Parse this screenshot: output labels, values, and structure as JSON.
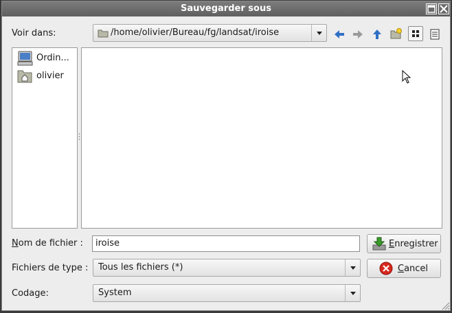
{
  "window": {
    "title": "Sauvegarder sous"
  },
  "location": {
    "label": "Voir dans:",
    "path": "/home/olivier/Bureau/fg/landsat/iroise"
  },
  "toolbar": {
    "icons": [
      "back-arrow-icon",
      "forward-arrow-icon",
      "up-arrow-icon",
      "new-folder-icon",
      "icon-view-icon",
      "list-view-icon"
    ]
  },
  "places": [
    {
      "label": "Ordin...",
      "icon": "computer-icon"
    },
    {
      "label": "olivier",
      "icon": "home-folder-icon"
    }
  ],
  "filename": {
    "label_prefix": "N",
    "label_rest": "om de fichier :",
    "value": "iroise"
  },
  "filetype": {
    "label": "Fichiers de type :",
    "selected": "Tous les fichiers (*)"
  },
  "encoding": {
    "label": "Codage:",
    "selected": "System"
  },
  "buttons": {
    "save_prefix": "E",
    "save_rest": "nregistrer",
    "cancel_prefix": "C",
    "cancel_rest": "ancel"
  },
  "colors": {
    "titlebar": "#6e6e6e",
    "accent_blue": "#2f6fc6",
    "cancel_red": "#d7281e"
  }
}
